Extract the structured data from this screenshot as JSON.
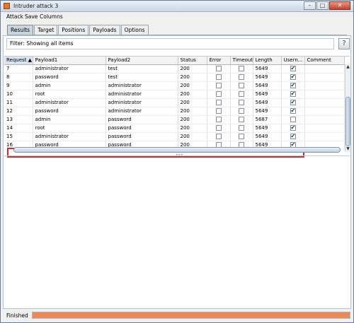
{
  "window": {
    "title": "Intruder attack 3"
  },
  "menu": [
    "Attack",
    "Save",
    "Columns"
  ],
  "tabs": [
    "Results",
    "Target",
    "Positions",
    "Payloads",
    "Options"
  ],
  "filter": {
    "text": "Filter: Showing all items"
  },
  "help_label": "?",
  "columns": [
    "Request",
    "Payload1",
    "Payload2",
    "Status",
    "Error",
    "Timeout",
    "Length",
    "Usern...",
    "Comment"
  ],
  "sort_indicator": "▲",
  "rows": [
    {
      "request": "7",
      "payload1": "administrator",
      "payload2": "test",
      "status": "200",
      "error": false,
      "timeout": false,
      "length": "5649",
      "username_match": true
    },
    {
      "request": "8",
      "payload1": "password",
      "payload2": "test",
      "status": "200",
      "error": false,
      "timeout": false,
      "length": "5649",
      "username_match": true
    },
    {
      "request": "9",
      "payload1": "admin",
      "payload2": "administrator",
      "status": "200",
      "error": false,
      "timeout": false,
      "length": "5649",
      "username_match": true
    },
    {
      "request": "10",
      "payload1": "root",
      "payload2": "administrator",
      "status": "200",
      "error": false,
      "timeout": false,
      "length": "5649",
      "username_match": true
    },
    {
      "request": "11",
      "payload1": "administrator",
      "payload2": "administrator",
      "status": "200",
      "error": false,
      "timeout": false,
      "length": "5649",
      "username_match": true
    },
    {
      "request": "12",
      "payload1": "password",
      "payload2": "administrator",
      "status": "200",
      "error": false,
      "timeout": false,
      "length": "5649",
      "username_match": true
    },
    {
      "request": "13",
      "payload1": "admin",
      "payload2": "password",
      "status": "200",
      "error": false,
      "timeout": false,
      "length": "5687",
      "username_match": false
    },
    {
      "request": "14",
      "payload1": "root",
      "payload2": "password",
      "status": "200",
      "error": false,
      "timeout": false,
      "length": "5649",
      "username_match": true
    },
    {
      "request": "15",
      "payload1": "administrator",
      "payload2": "password",
      "status": "200",
      "error": false,
      "timeout": false,
      "length": "5649",
      "username_match": true
    },
    {
      "request": "16",
      "payload1": "password",
      "payload2": "password",
      "status": "200",
      "error": false,
      "timeout": false,
      "length": "5649",
      "username_match": true
    }
  ],
  "highlighted_request": "13",
  "status": {
    "label": "Finished",
    "progress": 1.0
  },
  "colors": {
    "highlight_border": "#d42a2a",
    "progress_fill": "#ec8a57",
    "active_tab": "#c9d5e1"
  },
  "icons": {
    "app": "burp-icon",
    "minimize": "minimize-icon",
    "maximize": "maximize-icon",
    "close": "close-icon",
    "check": "checkmark-icon"
  }
}
